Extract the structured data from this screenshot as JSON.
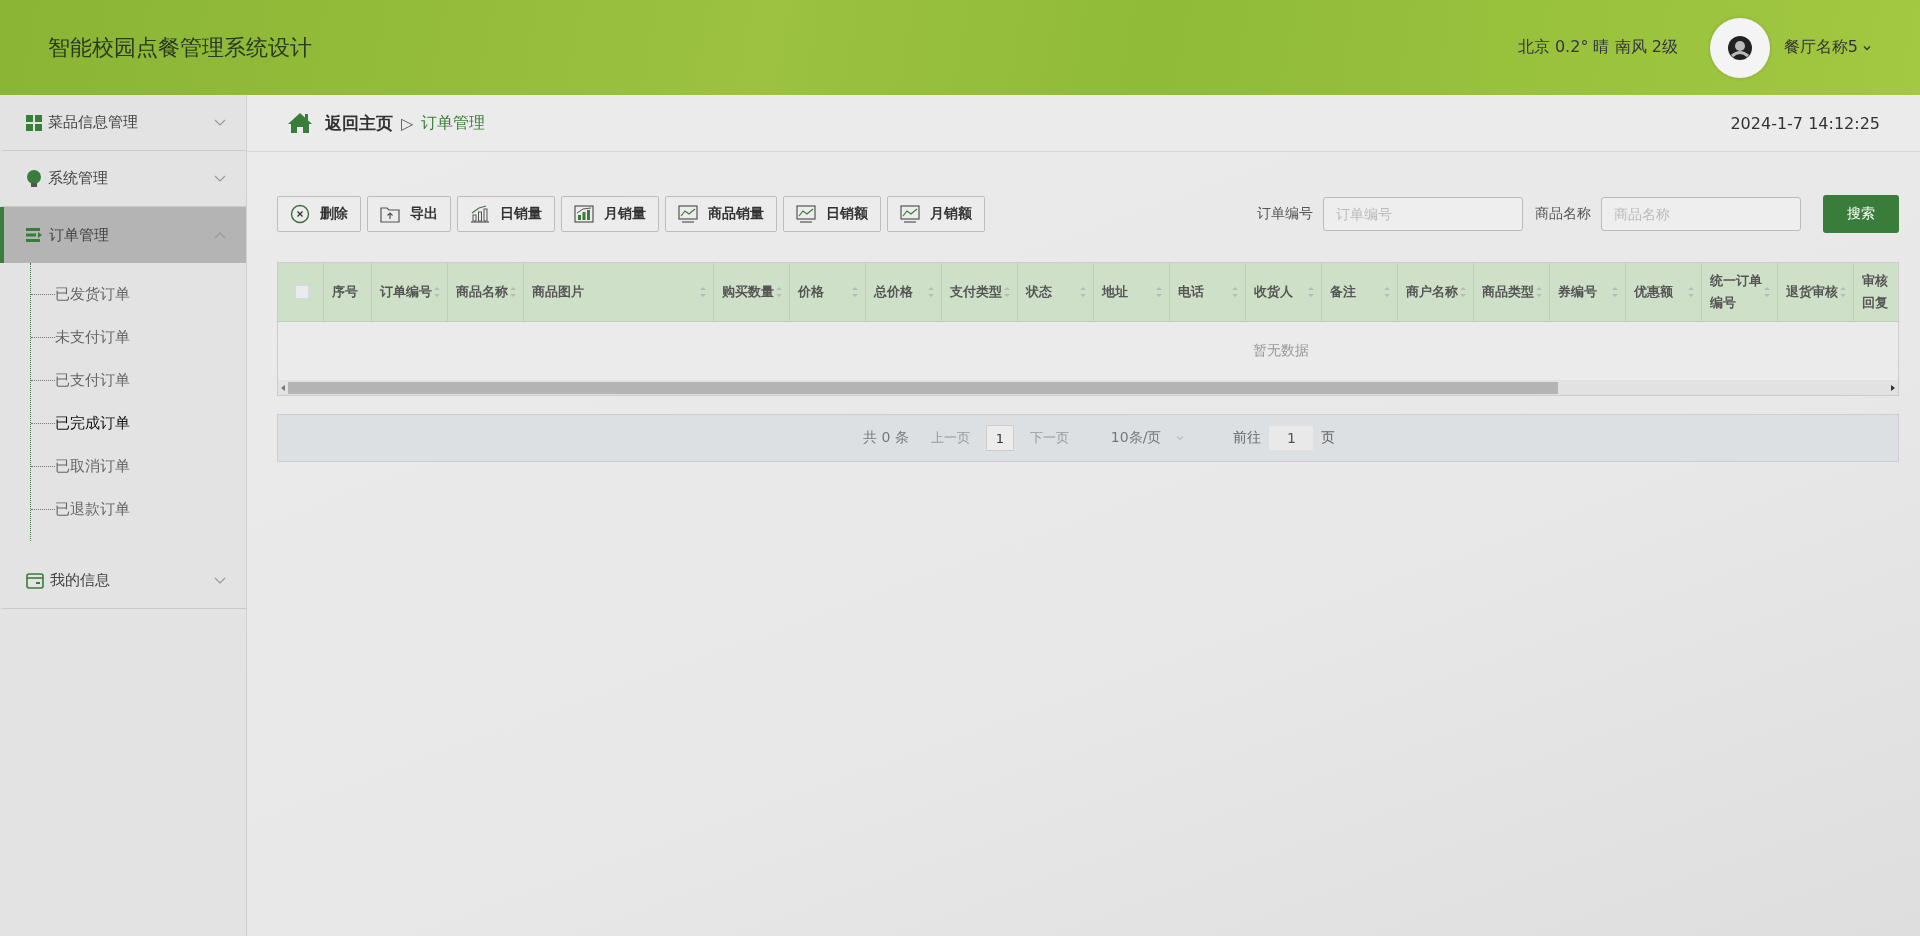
{
  "header": {
    "title": "智能校园点餐管理系统设计",
    "weather": "北京 0.2° 晴 南风 2级",
    "user": "餐厅名称5"
  },
  "sidebar": {
    "items": [
      {
        "label": "菜品信息管理",
        "kind": "grid",
        "expanded": false
      },
      {
        "label": "系统管理",
        "kind": "bulb",
        "expanded": false
      },
      {
        "label": "订单管理",
        "kind": "list",
        "expanded": true,
        "children": [
          {
            "label": "已发货订单",
            "selected": false
          },
          {
            "label": "未支付订单",
            "selected": false
          },
          {
            "label": "已支付订单",
            "selected": false
          },
          {
            "label": "已完成订单",
            "selected": true
          },
          {
            "label": "已取消订单",
            "selected": false
          },
          {
            "label": "已退款订单",
            "selected": false
          }
        ]
      },
      {
        "label": "我的信息",
        "kind": "wallet",
        "expanded": false
      }
    ]
  },
  "breadcrumb": {
    "home": "返回主页",
    "separator": "▷",
    "current": "订单管理",
    "datetime": "2024-1-7 14:12:25"
  },
  "toolbar": [
    {
      "label": "删除",
      "kind": "delete"
    },
    {
      "label": "导出",
      "kind": "export"
    },
    {
      "label": "日销量",
      "kind": "bars"
    },
    {
      "label": "月销量",
      "kind": "bars2"
    },
    {
      "label": "商品销量",
      "kind": "line"
    },
    {
      "label": "日销额",
      "kind": "line"
    },
    {
      "label": "月销额",
      "kind": "line"
    }
  ],
  "search": [
    {
      "label": "订单编号",
      "placeholder": "订单编号"
    },
    {
      "label": "商品名称",
      "placeholder": "商品名称"
    }
  ],
  "search_button": "搜索",
  "table": {
    "select_all": false,
    "columns": [
      {
        "label": "序号",
        "sortable": false
      },
      {
        "label": "订单编号",
        "sortable": true
      },
      {
        "label": "商品名称",
        "sortable": true
      },
      {
        "label": "商品图片",
        "sortable": true
      },
      {
        "label": "购买数量",
        "sortable": true
      },
      {
        "label": "价格",
        "sortable": true
      },
      {
        "label": "总价格",
        "sortable": true
      },
      {
        "label": "支付类型",
        "sortable": true
      },
      {
        "label": "状态",
        "sortable": true
      },
      {
        "label": "地址",
        "sortable": true
      },
      {
        "label": "电话",
        "sortable": true
      },
      {
        "label": "收货人",
        "sortable": true
      },
      {
        "label": "备注",
        "sortable": true
      },
      {
        "label": "商户名称",
        "sortable": true
      },
      {
        "label": "商品类型",
        "sortable": true
      },
      {
        "label": "券编号",
        "sortable": true
      },
      {
        "label": "优惠额",
        "sortable": true
      },
      {
        "label": "统一订单编号",
        "sortable": true
      },
      {
        "label": "退货审核",
        "sortable": true
      },
      {
        "label": "审核回复",
        "sortable": false
      }
    ],
    "empty": "暂无数据"
  },
  "pagination": {
    "total": "共 0 条",
    "prev": "上一页",
    "page": "1",
    "next": "下一页",
    "size": "10条/页",
    "goto": "前往",
    "goto_value": "1",
    "page_unit": "页"
  }
}
